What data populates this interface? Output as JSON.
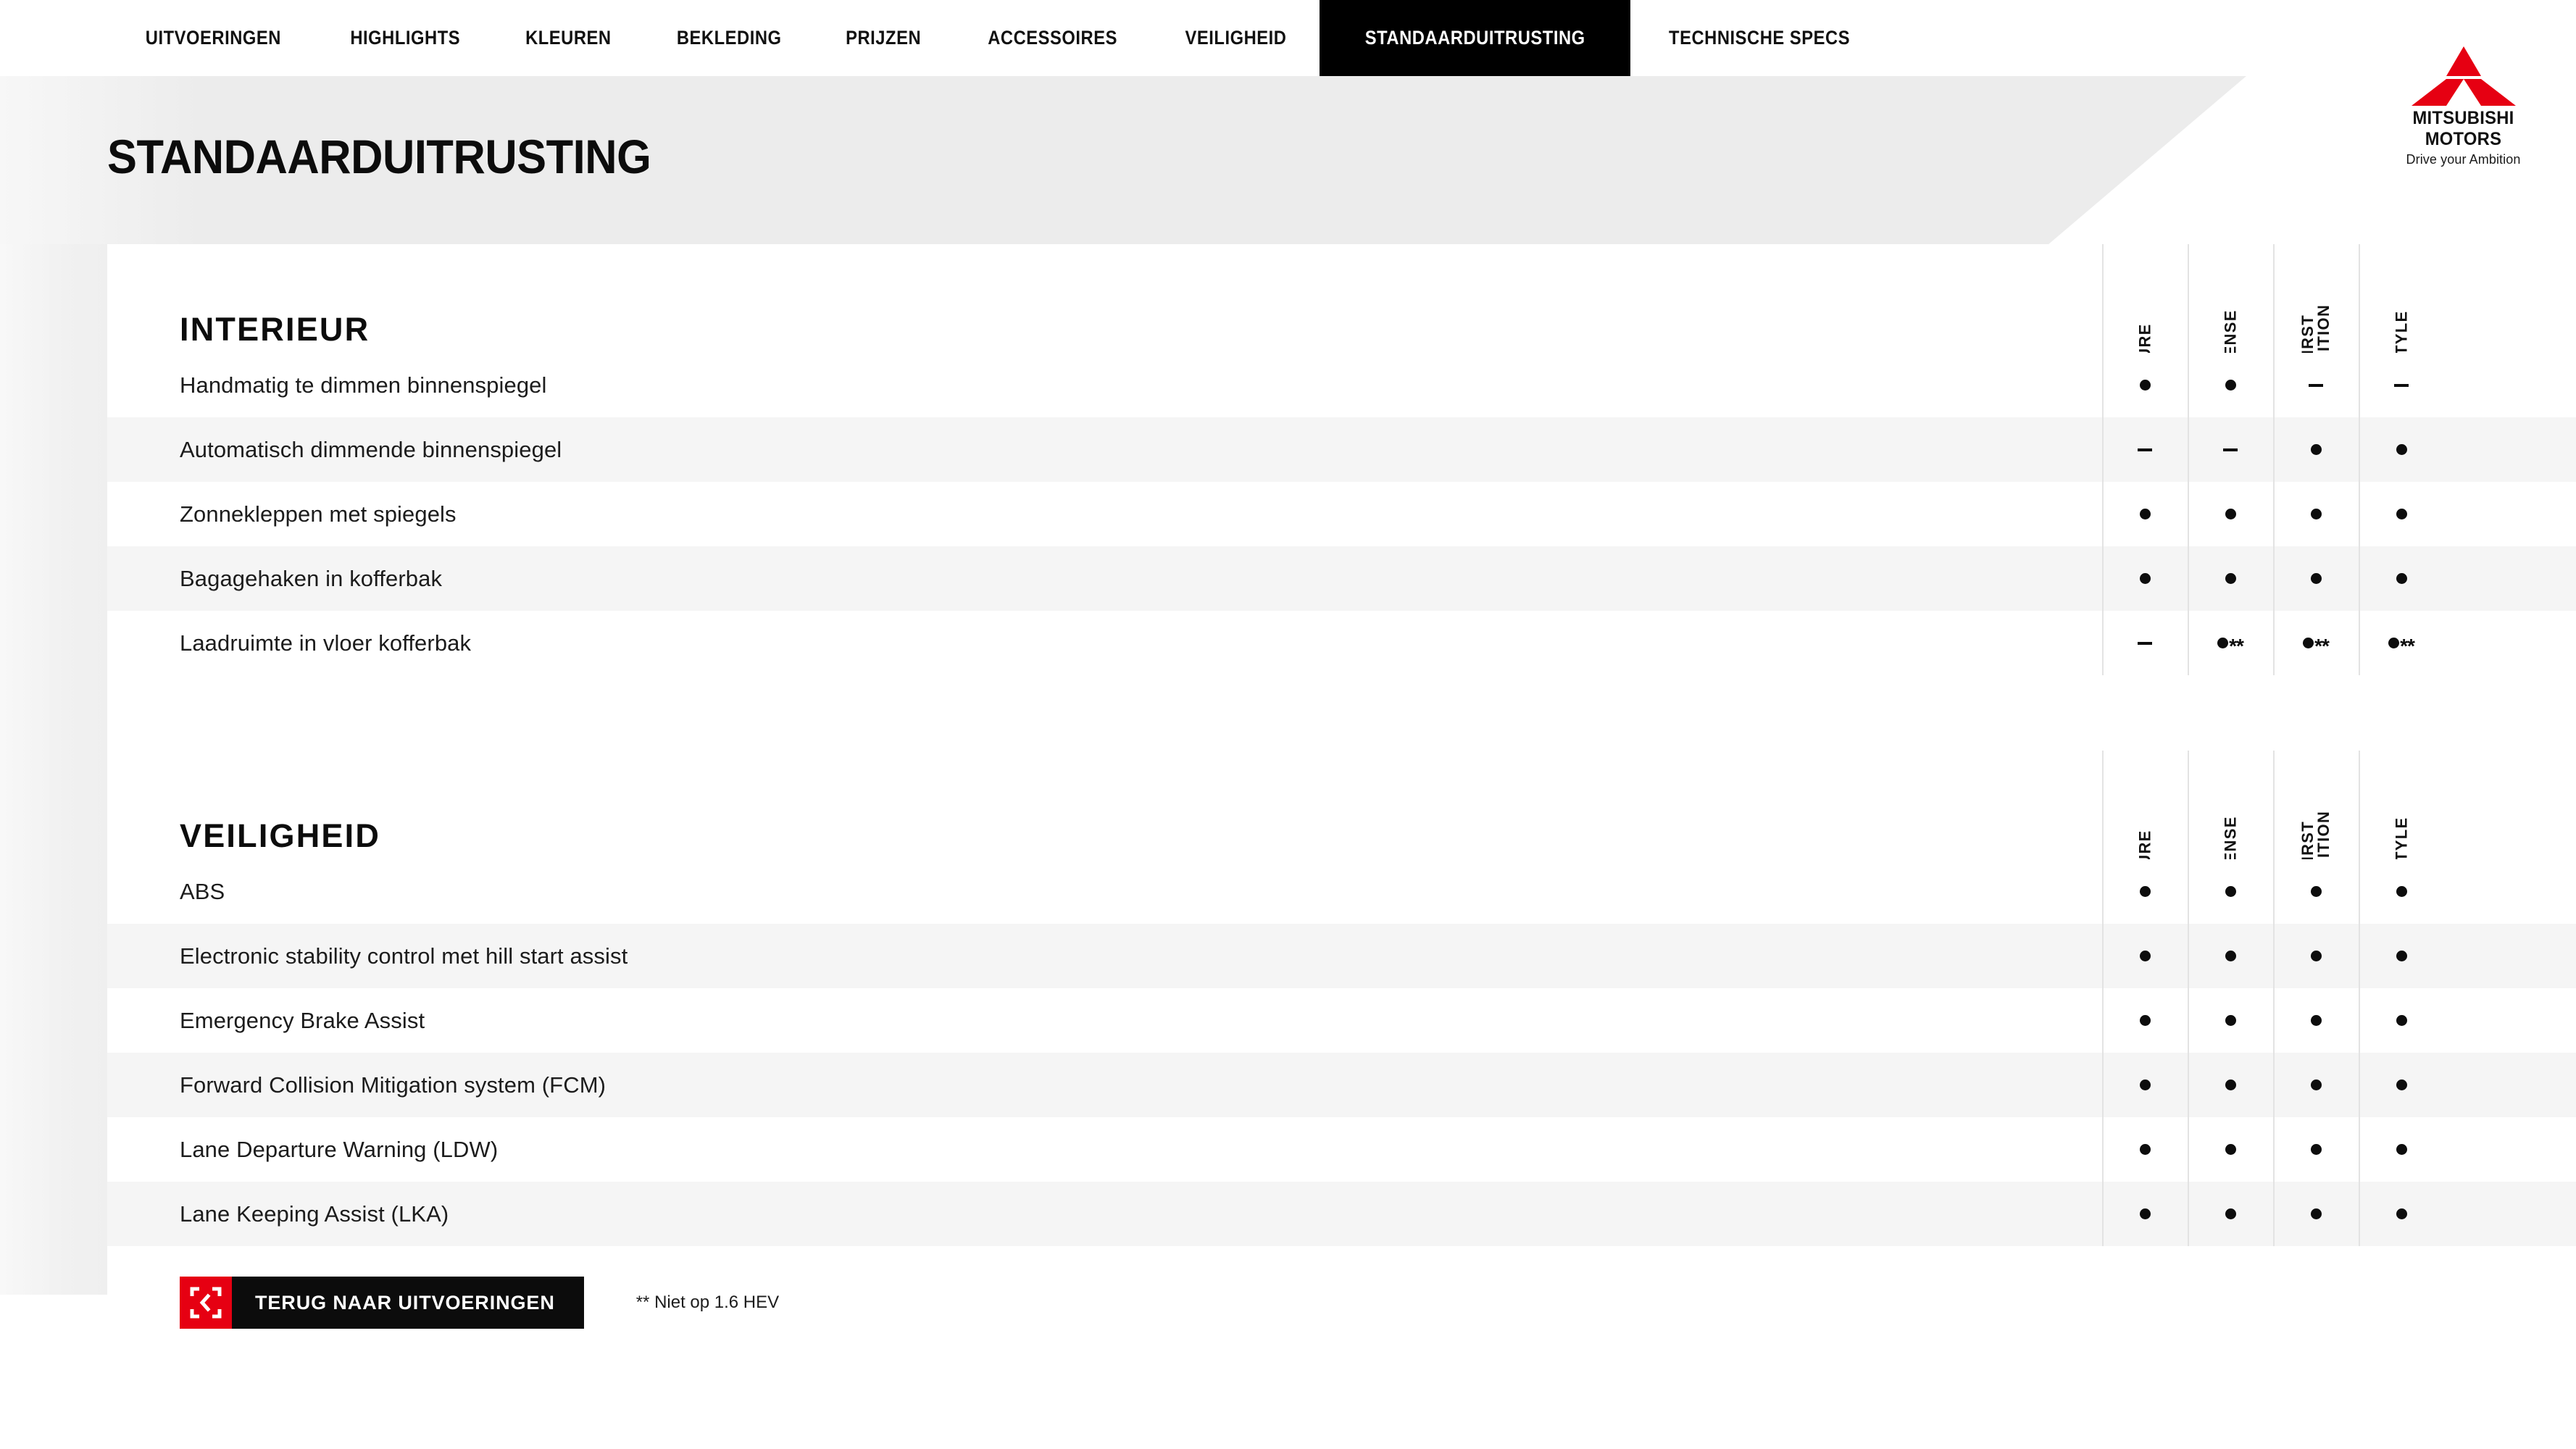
{
  "brand": {
    "name_line1": "MITSUBISHI",
    "name_line2": "MOTORS",
    "tagline": "Drive your Ambition",
    "red": "#e60012"
  },
  "nav": {
    "items": [
      {
        "label": "UITVOERINGEN",
        "active": false
      },
      {
        "label": "HIGHLIGHTS",
        "active": false
      },
      {
        "label": "KLEUREN",
        "active": false
      },
      {
        "label": "BEKLEDING",
        "active": false
      },
      {
        "label": "PRIJZEN",
        "active": false
      },
      {
        "label": "ACCESSOIRES",
        "active": false
      },
      {
        "label": "VEILIGHEID",
        "active": false
      },
      {
        "label": "STANDAARDUITRUSTING",
        "active": true
      },
      {
        "label": "TECHNISCHE SPECS",
        "active": false
      }
    ]
  },
  "page": {
    "title": "STANDAARDUITRUSTING"
  },
  "columns": [
    "PURE",
    "INTENSE",
    "FIRST EDITION",
    "INSTYLE"
  ],
  "sections": [
    {
      "title": "INTERIEUR",
      "columns": [
        "PURE",
        "INTENSE",
        "FIRST EDITION",
        "INSTYLE"
      ],
      "rows": [
        {
          "label": "Handmatig te dimmen binnenspiegel",
          "values": [
            "dot",
            "dot",
            "dash",
            "dash"
          ]
        },
        {
          "label": "Automatisch dimmende binnenspiegel",
          "values": [
            "dash",
            "dash",
            "dot",
            "dot"
          ]
        },
        {
          "label": "Zonnekleppen met spiegels",
          "values": [
            "dot",
            "dot",
            "dot",
            "dot"
          ]
        },
        {
          "label": "Bagagehaken in kofferbak",
          "values": [
            "dot",
            "dot",
            "dot",
            "dot"
          ]
        },
        {
          "label": "Laadruimte in vloer kofferbak",
          "values": [
            "dash",
            "dot**",
            "dot**",
            "dot**"
          ]
        }
      ]
    },
    {
      "title": "VEILIGHEID",
      "columns": [
        "PURE",
        "INTENSE",
        "FIRST EDITION",
        "INSTYLE"
      ],
      "rows": [
        {
          "label": "ABS",
          "values": [
            "dot",
            "dot",
            "dot",
            "dot"
          ]
        },
        {
          "label": "Electronic stability control met hill start assist",
          "values": [
            "dot",
            "dot",
            "dot",
            "dot"
          ]
        },
        {
          "label": "Emergency Brake Assist",
          "values": [
            "dot",
            "dot",
            "dot",
            "dot"
          ]
        },
        {
          "label": "Forward Collision Mitigation system (FCM)",
          "values": [
            "dot",
            "dot",
            "dot",
            "dot"
          ]
        },
        {
          "label": "Lane Departure Warning (LDW)",
          "values": [
            "dot",
            "dot",
            "dot",
            "dot"
          ]
        },
        {
          "label": "Lane Keeping Assist (LKA)",
          "values": [
            "dot",
            "dot",
            "dot",
            "dot"
          ]
        }
      ]
    }
  ],
  "footer": {
    "back_label": "TERUG NAAR UITVOERINGEN",
    "footnote": "** Niet op 1.6 HEV"
  }
}
